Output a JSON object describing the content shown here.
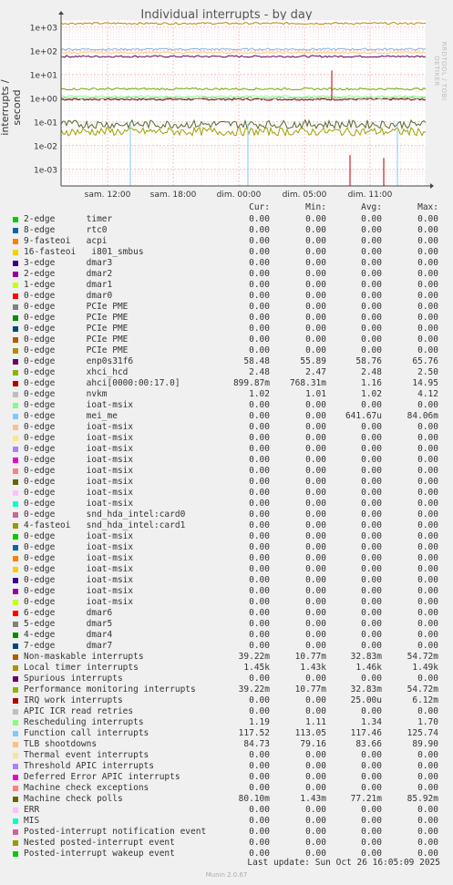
{
  "chart_data": {
    "type": "line",
    "title": "Individual interrupts - by day",
    "ylabel": "interrupts / second",
    "yscale": "log",
    "ylim": [
      0.0002,
      2000
    ],
    "yticks": [
      "1e+03",
      "1e+02",
      "1e+01",
      "1e+00",
      "1e-01",
      "1e-02",
      "1e-03"
    ],
    "xticks": [
      "sam. 12:00",
      "sam. 18:00",
      "dim. 00:00",
      "dim. 05:00",
      "dim. 11:00"
    ],
    "grid": true,
    "series": [
      {
        "name": "ahci[0000:00:17.0]",
        "color": "#7a0000",
        "level": 0.9,
        "spikes": []
      },
      {
        "name": "enp0s31f6",
        "color": "#5c0a5c",
        "level": 58.48,
        "spikes": []
      },
      {
        "name": "Local timer interrupts",
        "color": "#b8860b",
        "level": 1450,
        "spikes": []
      },
      {
        "name": "Function call interrupts",
        "color": "#80b0ee",
        "level": 117.52,
        "spikes": []
      },
      {
        "name": "TLB shootdowns",
        "color": "#ffcc80",
        "level": 84.73,
        "spikes": []
      },
      {
        "name": "xhci_hcd",
        "color": "#66aa00",
        "level": 2.48,
        "spikes": []
      },
      {
        "name": "nvkm",
        "color": "#aaaaaa",
        "level": 1.02,
        "spikes": []
      },
      {
        "name": "Rescheduling interrupts",
        "color": "#88ff88",
        "level": 1.19,
        "spikes": []
      },
      {
        "name": "Machine check polls",
        "color": "#556b2f",
        "level": 0.08,
        "spikes": []
      },
      {
        "name": "Non-maskable interrupts",
        "color": "#a0a000",
        "level": 0.0392,
        "spikes": []
      }
    ]
  },
  "rrdtool_tag": "RRDTOOL / TOBI OETIKER",
  "headers": {
    "cur": "Cur:",
    "min": "Min:",
    "avg": "Avg:",
    "max": "Max:"
  },
  "legend": [
    {
      "name": "2-edge      timer",
      "color": "#00cc00",
      "cur": "0.00",
      "min": "0.00",
      "avg": "0.00",
      "max": "0.00"
    },
    {
      "name": "8-edge      rtc0",
      "color": "#0066b3",
      "cur": "0.00",
      "min": "0.00",
      "avg": "0.00",
      "max": "0.00"
    },
    {
      "name": "9-fasteoi   acpi",
      "color": "#ff8000",
      "cur": "0.00",
      "min": "0.00",
      "avg": "0.00",
      "max": "0.00"
    },
    {
      "name": "16-fasteoi   i801_smbus",
      "color": "#ffcc00",
      "cur": "0.00",
      "min": "0.00",
      "avg": "0.00",
      "max": "0.00"
    },
    {
      "name": "3-edge      dmar3",
      "color": "#330099",
      "cur": "0.00",
      "min": "0.00",
      "avg": "0.00",
      "max": "0.00"
    },
    {
      "name": "2-edge      dmar2",
      "color": "#990099",
      "cur": "0.00",
      "min": "0.00",
      "avg": "0.00",
      "max": "0.00"
    },
    {
      "name": "1-edge      dmar1",
      "color": "#ccff00",
      "cur": "0.00",
      "min": "0.00",
      "avg": "0.00",
      "max": "0.00"
    },
    {
      "name": "0-edge      dmar0",
      "color": "#ff0000",
      "cur": "0.00",
      "min": "0.00",
      "avg": "0.00",
      "max": "0.00"
    },
    {
      "name": "0-edge      PCIe PME",
      "color": "#808080",
      "cur": "0.00",
      "min": "0.00",
      "avg": "0.00",
      "max": "0.00"
    },
    {
      "name": "0-edge      PCIe PME",
      "color": "#008f00",
      "cur": "0.00",
      "min": "0.00",
      "avg": "0.00",
      "max": "0.00"
    },
    {
      "name": "0-edge      PCIe PME",
      "color": "#00487d",
      "cur": "0.00",
      "min": "0.00",
      "avg": "0.00",
      "max": "0.00"
    },
    {
      "name": "0-edge      PCIe PME",
      "color": "#b35a00",
      "cur": "0.00",
      "min": "0.00",
      "avg": "0.00",
      "max": "0.00"
    },
    {
      "name": "0-edge      PCIe PME",
      "color": "#b38f00",
      "cur": "0.00",
      "min": "0.00",
      "avg": "0.00",
      "max": "0.00"
    },
    {
      "name": "0-edge      enp0s31f6",
      "color": "#6b006b",
      "cur": "58.48",
      "min": "55.89",
      "avg": "58.76",
      "max": "65.76"
    },
    {
      "name": "0-edge      xhci_hcd",
      "color": "#8fb300",
      "cur": "2.48",
      "min": "2.47",
      "avg": "2.48",
      "max": "2.50"
    },
    {
      "name": "0-edge      ahci[0000:00:17.0]",
      "color": "#b30000",
      "cur": "899.87m",
      "min": "768.31m",
      "avg": "1.16",
      "max": "14.95"
    },
    {
      "name": "0-edge      nvkm",
      "color": "#bebebe",
      "cur": "1.02",
      "min": "1.01",
      "avg": "1.02",
      "max": "4.12"
    },
    {
      "name": "0-edge      ioat-msix",
      "color": "#80ff80",
      "cur": "0.00",
      "min": "0.00",
      "avg": "0.00",
      "max": "0.00"
    },
    {
      "name": "0-edge      mei_me",
      "color": "#80c9ff",
      "cur": "0.00",
      "min": "0.00",
      "avg": "641.67u",
      "max": "84.06m"
    },
    {
      "name": "0-edge      ioat-msix",
      "color": "#ffc080",
      "cur": "0.00",
      "min": "0.00",
      "avg": "0.00",
      "max": "0.00"
    },
    {
      "name": "0-edge      ioat-msix",
      "color": "#ffe680",
      "cur": "0.00",
      "min": "0.00",
      "avg": "0.00",
      "max": "0.00"
    },
    {
      "name": "0-edge      ioat-msix",
      "color": "#aa80ff",
      "cur": "0.00",
      "min": "0.00",
      "avg": "0.00",
      "max": "0.00"
    },
    {
      "name": "0-edge      ioat-msix",
      "color": "#ee00cc",
      "cur": "0.00",
      "min": "0.00",
      "avg": "0.00",
      "max": "0.00"
    },
    {
      "name": "0-edge      ioat-msix",
      "color": "#ff8080",
      "cur": "0.00",
      "min": "0.00",
      "avg": "0.00",
      "max": "0.00"
    },
    {
      "name": "0-edge      ioat-msix",
      "color": "#666600",
      "cur": "0.00",
      "min": "0.00",
      "avg": "0.00",
      "max": "0.00"
    },
    {
      "name": "0-edge      ioat-msix",
      "color": "#ffbfff",
      "cur": "0.00",
      "min": "0.00",
      "avg": "0.00",
      "max": "0.00"
    },
    {
      "name": "0-edge      ioat-msix",
      "color": "#00ffcc",
      "cur": "0.00",
      "min": "0.00",
      "avg": "0.00",
      "max": "0.00"
    },
    {
      "name": "0-edge      snd_hda_intel:card0",
      "color": "#cc6699",
      "cur": "0.00",
      "min": "0.00",
      "avg": "0.00",
      "max": "0.00"
    },
    {
      "name": "4-fasteoi   snd_hda_intel:card1",
      "color": "#999900",
      "cur": "0.00",
      "min": "0.00",
      "avg": "0.00",
      "max": "0.00"
    },
    {
      "name": "0-edge      ioat-msix",
      "color": "#00cc00",
      "cur": "0.00",
      "min": "0.00",
      "avg": "0.00",
      "max": "0.00"
    },
    {
      "name": "0-edge      ioat-msix",
      "color": "#0066b3",
      "cur": "0.00",
      "min": "0.00",
      "avg": "0.00",
      "max": "0.00"
    },
    {
      "name": "0-edge      ioat-msix",
      "color": "#ff8000",
      "cur": "0.00",
      "min": "0.00",
      "avg": "0.00",
      "max": "0.00"
    },
    {
      "name": "0-edge      ioat-msix",
      "color": "#ffcc00",
      "cur": "0.00",
      "min": "0.00",
      "avg": "0.00",
      "max": "0.00"
    },
    {
      "name": "0-edge      ioat-msix",
      "color": "#330099",
      "cur": "0.00",
      "min": "0.00",
      "avg": "0.00",
      "max": "0.00"
    },
    {
      "name": "0-edge      ioat-msix",
      "color": "#990099",
      "cur": "0.00",
      "min": "0.00",
      "avg": "0.00",
      "max": "0.00"
    },
    {
      "name": "0-edge      ioat-msix",
      "color": "#ccff00",
      "cur": "0.00",
      "min": "0.00",
      "avg": "0.00",
      "max": "0.00"
    },
    {
      "name": "6-edge      dmar6",
      "color": "#ff0000",
      "cur": "0.00",
      "min": "0.00",
      "avg": "0.00",
      "max": "0.00"
    },
    {
      "name": "5-edge      dmar5",
      "color": "#808080",
      "cur": "0.00",
      "min": "0.00",
      "avg": "0.00",
      "max": "0.00"
    },
    {
      "name": "4-edge      dmar4",
      "color": "#008f00",
      "cur": "0.00",
      "min": "0.00",
      "avg": "0.00",
      "max": "0.00"
    },
    {
      "name": "7-edge      dmar7",
      "color": "#00487d",
      "cur": "0.00",
      "min": "0.00",
      "avg": "0.00",
      "max": "0.00"
    },
    {
      "name": "Non-maskable interrupts",
      "color": "#b35a00",
      "cur": "39.22m",
      "min": "10.77m",
      "avg": "32.83m",
      "max": "54.72m"
    },
    {
      "name": "Local timer interrupts",
      "color": "#b38f00",
      "cur": "1.45k",
      "min": "1.43k",
      "avg": "1.46k",
      "max": "1.49k"
    },
    {
      "name": "Spurious interrupts",
      "color": "#6b006b",
      "cur": "0.00",
      "min": "0.00",
      "avg": "0.00",
      "max": "0.00"
    },
    {
      "name": "Performance monitoring interrupts",
      "color": "#8fb300",
      "cur": "39.22m",
      "min": "10.77m",
      "avg": "32.83m",
      "max": "54.72m"
    },
    {
      "name": "IRQ work interrupts",
      "color": "#b30000",
      "cur": "0.00",
      "min": "0.00",
      "avg": "25.00u",
      "max": "6.12m"
    },
    {
      "name": "APIC ICR read retries",
      "color": "#bebebe",
      "cur": "0.00",
      "min": "0.00",
      "avg": "0.00",
      "max": "0.00"
    },
    {
      "name": "Rescheduling interrupts",
      "color": "#80ff80",
      "cur": "1.19",
      "min": "1.11",
      "avg": "1.34",
      "max": "1.70"
    },
    {
      "name": "Function call interrupts",
      "color": "#80c9ff",
      "cur": "117.52",
      "min": "113.05",
      "avg": "117.46",
      "max": "125.74"
    },
    {
      "name": "TLB shootdowns",
      "color": "#ffc080",
      "cur": "84.73",
      "min": "79.16",
      "avg": "83.66",
      "max": "89.90"
    },
    {
      "name": "Thermal event interrupts",
      "color": "#ffe680",
      "cur": "0.00",
      "min": "0.00",
      "avg": "0.00",
      "max": "0.00"
    },
    {
      "name": "Threshold APIC interrupts",
      "color": "#aa80ff",
      "cur": "0.00",
      "min": "0.00",
      "avg": "0.00",
      "max": "0.00"
    },
    {
      "name": "Deferred Error APIC interrupts",
      "color": "#ee00cc",
      "cur": "0.00",
      "min": "0.00",
      "avg": "0.00",
      "max": "0.00"
    },
    {
      "name": "Machine check exceptions",
      "color": "#ff8080",
      "cur": "0.00",
      "min": "0.00",
      "avg": "0.00",
      "max": "0.00"
    },
    {
      "name": "Machine check polls",
      "color": "#666600",
      "cur": "80.10m",
      "min": "1.43m",
      "avg": "77.21m",
      "max": "85.92m"
    },
    {
      "name": "ERR",
      "color": "#ffbfff",
      "cur": "0.00",
      "min": "0.00",
      "avg": "0.00",
      "max": "0.00"
    },
    {
      "name": "MIS",
      "color": "#00ffcc",
      "cur": "0.00",
      "min": "0.00",
      "avg": "0.00",
      "max": "0.00"
    },
    {
      "name": "Posted-interrupt notification event",
      "color": "#cc6699",
      "cur": "0.00",
      "min": "0.00",
      "avg": "0.00",
      "max": "0.00"
    },
    {
      "name": "Nested posted-interrupt event",
      "color": "#999900",
      "cur": "0.00",
      "min": "0.00",
      "avg": "0.00",
      "max": "0.00"
    },
    {
      "name": "Posted-interrupt wakeup event",
      "color": "#00cc00",
      "cur": "0.00",
      "min": "0.00",
      "avg": "0.00",
      "max": "0.00"
    }
  ],
  "last_update": "Last update: Sun Oct 26 16:05:09 2025",
  "munin_version": "Munin 2.0.67"
}
